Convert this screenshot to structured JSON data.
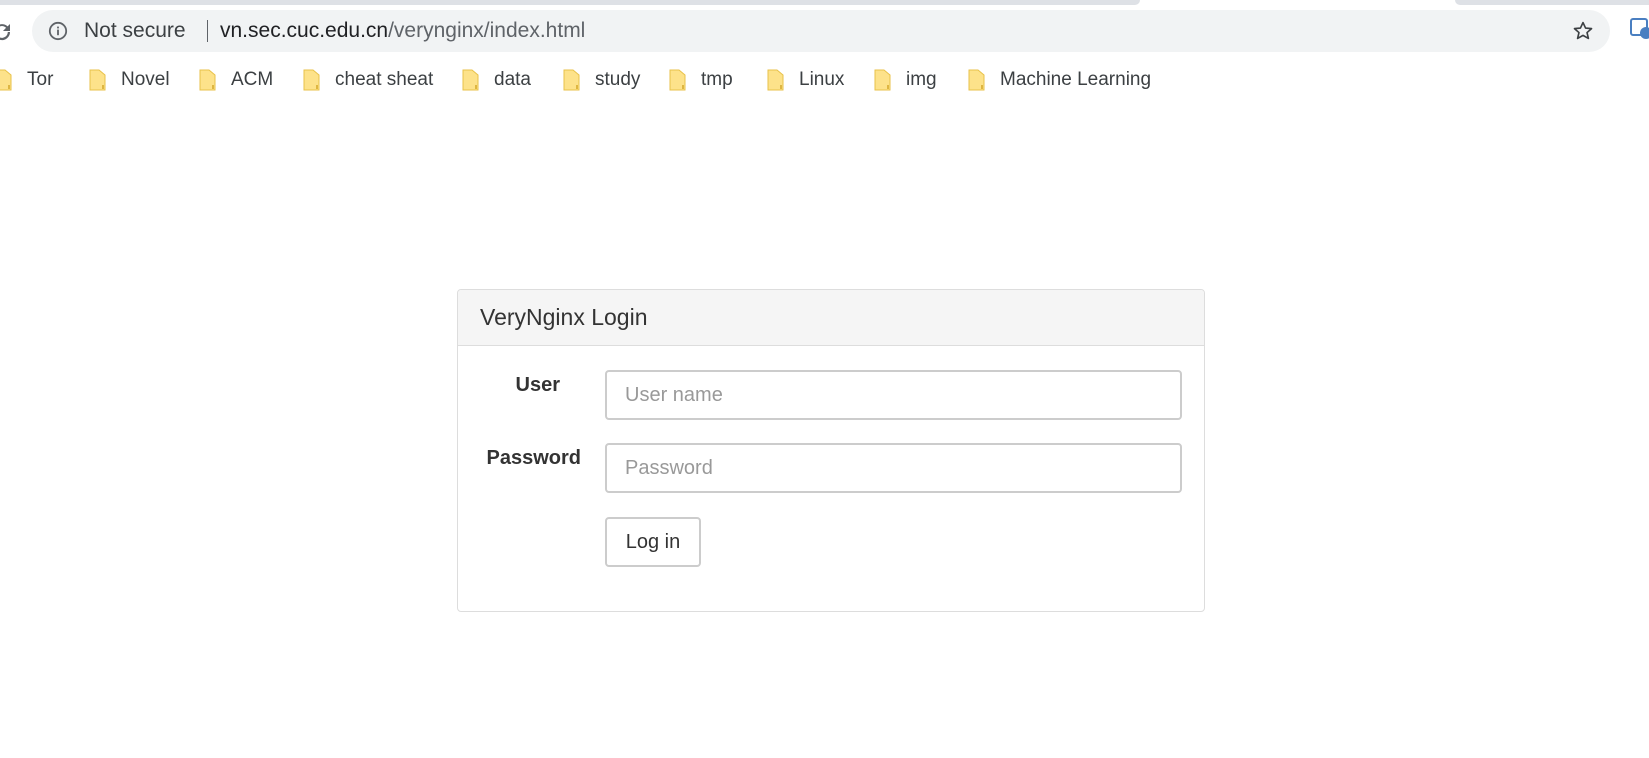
{
  "browser": {
    "security_label": "Not secure",
    "url_host": "vn.sec.cuc.edu.cn",
    "url_path": "/verynginx/index.html",
    "icons": {
      "reload": "reload-icon",
      "info": "info-icon",
      "bookmark_star": "star-icon",
      "extension": "extension-icon",
      "folder": "folder-icon"
    },
    "bookmarks": [
      {
        "label": "Tor"
      },
      {
        "label": "Novel"
      },
      {
        "label": "ACM"
      },
      {
        "label": "cheat sheat"
      },
      {
        "label": "data"
      },
      {
        "label": "study"
      },
      {
        "label": "tmp"
      },
      {
        "label": "Linux"
      },
      {
        "label": "img"
      },
      {
        "label": "Machine Learning"
      }
    ]
  },
  "login": {
    "title": "VeryNginx Login",
    "user_label": "User",
    "user_placeholder": "User name",
    "user_value": "",
    "password_label": "Password",
    "password_placeholder": "Password",
    "password_value": "",
    "submit_label": "Log in"
  },
  "colors": {
    "folder": "#fde28a",
    "panel_border": "#dddddd",
    "panel_heading_bg": "#f5f5f5",
    "omnibox_bg": "#f1f3f4"
  }
}
